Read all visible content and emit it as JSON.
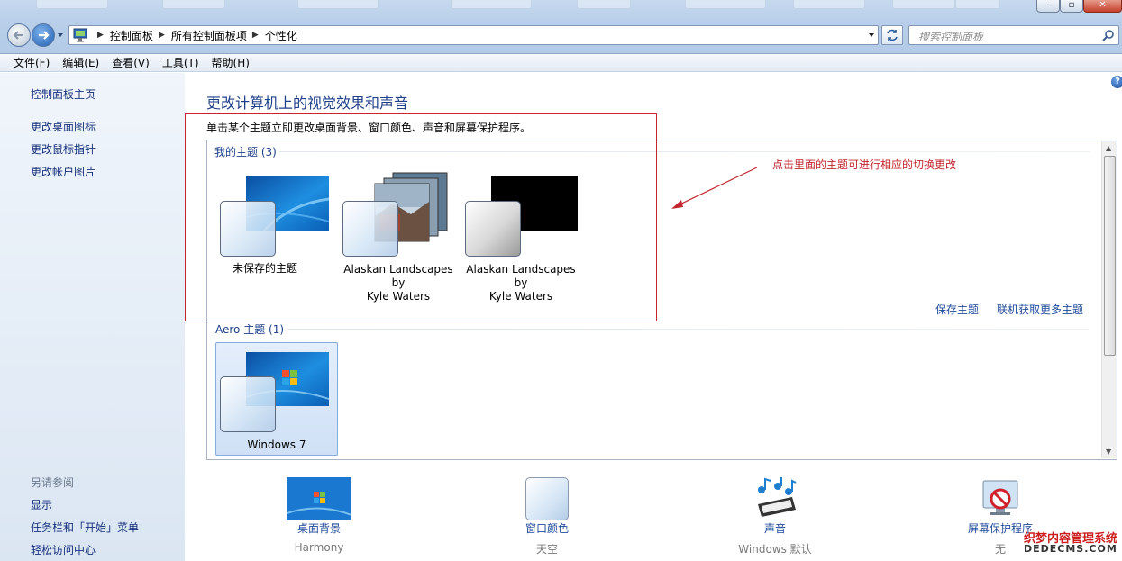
{
  "address_bar": {
    "crumbs": [
      "控制面板",
      "所有控制面板项",
      "个性化"
    ],
    "search_placeholder": "搜索控制面板"
  },
  "menu": [
    "文件(F)",
    "编辑(E)",
    "查看(V)",
    "工具(T)",
    "帮助(H)"
  ],
  "sidebar": {
    "home": "控制面板主页",
    "links": [
      "更改桌面图标",
      "更改鼠标指针",
      "更改帐户图片"
    ],
    "see_also_heading": "另请参阅",
    "see_also": [
      "显示",
      "任务栏和「开始」菜单",
      "轻松访问中心"
    ]
  },
  "main": {
    "title": "更改计算机上的视觉效果和声音",
    "description": "单击某个主题立即更改桌面背景、窗口颜色、声音和屏幕保护程序。",
    "my_themes": {
      "label": "我的主题 (3)",
      "items": [
        {
          "label": "未保存的主题"
        },
        {
          "label_line1": "Alaskan Landscapes by",
          "label_line2": "Kyle Waters"
        },
        {
          "label_line1": "Alaskan Landscapes by",
          "label_line2": "Kyle Waters"
        }
      ]
    },
    "save_theme": "保存主题",
    "get_more_themes": "联机获取更多主题",
    "aero_themes": {
      "label": "Aero 主题 (1)",
      "items": [
        {
          "label": "Windows 7"
        }
      ]
    },
    "annotation": "点击里面的主题可进行相应的切换更改"
  },
  "bottom": [
    {
      "title": "桌面背景",
      "sub": "Harmony",
      "icon": "desktop-background-icon"
    },
    {
      "title": "窗口颜色",
      "sub": "天空",
      "icon": "window-color-icon"
    },
    {
      "title": "声音",
      "sub": "Windows 默认",
      "icon": "sound-icon"
    },
    {
      "title": "屏幕保护程序",
      "sub": "无",
      "icon": "screensaver-icon"
    }
  ],
  "watermark": {
    "line1": "织梦内容管理系统",
    "line2": "DEDECMS.COM"
  },
  "colors": {
    "link": "#1e4a9a",
    "title": "#1e3f8a",
    "annotation": "#c2262e"
  }
}
